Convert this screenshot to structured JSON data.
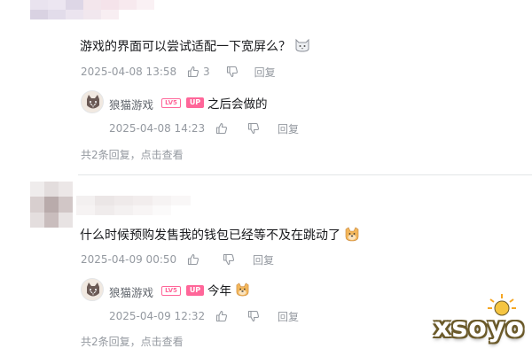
{
  "colors": {
    "text_primary": "#18191c",
    "text_secondary": "#9499a0",
    "username": "#61666d",
    "badge_pink": "#ff6699",
    "divider": "#e3e5e7"
  },
  "comments": [
    {
      "text": "游戏的界面可以尝试适配一下宽屏么？",
      "emoji": "cat-face-emoji",
      "date": "2025-04-08 13:58",
      "likes": "3",
      "reply_label": "回复",
      "reply": {
        "username": "狼猫游戏",
        "level_badge": "LV5",
        "up_badge": "UP",
        "text": "之后会做的",
        "date": "2025-04-08 14:23",
        "reply_label": "回复"
      },
      "summary": "共2条回复，点击查看"
    },
    {
      "text": "什么时候预购发售我的钱包已经等不及在跳动了",
      "emoji": "doge-emoji",
      "date": "2025-04-09 00:50",
      "likes": "",
      "reply_label": "回复",
      "reply": {
        "username": "狼猫游戏",
        "level_badge": "LV5",
        "up_badge": "UP",
        "text": "今年",
        "date": "2025-04-09 12:32",
        "reply_label": "回复"
      },
      "summary": "共2条回复，点击查看"
    }
  ],
  "watermark": "xsoyo"
}
